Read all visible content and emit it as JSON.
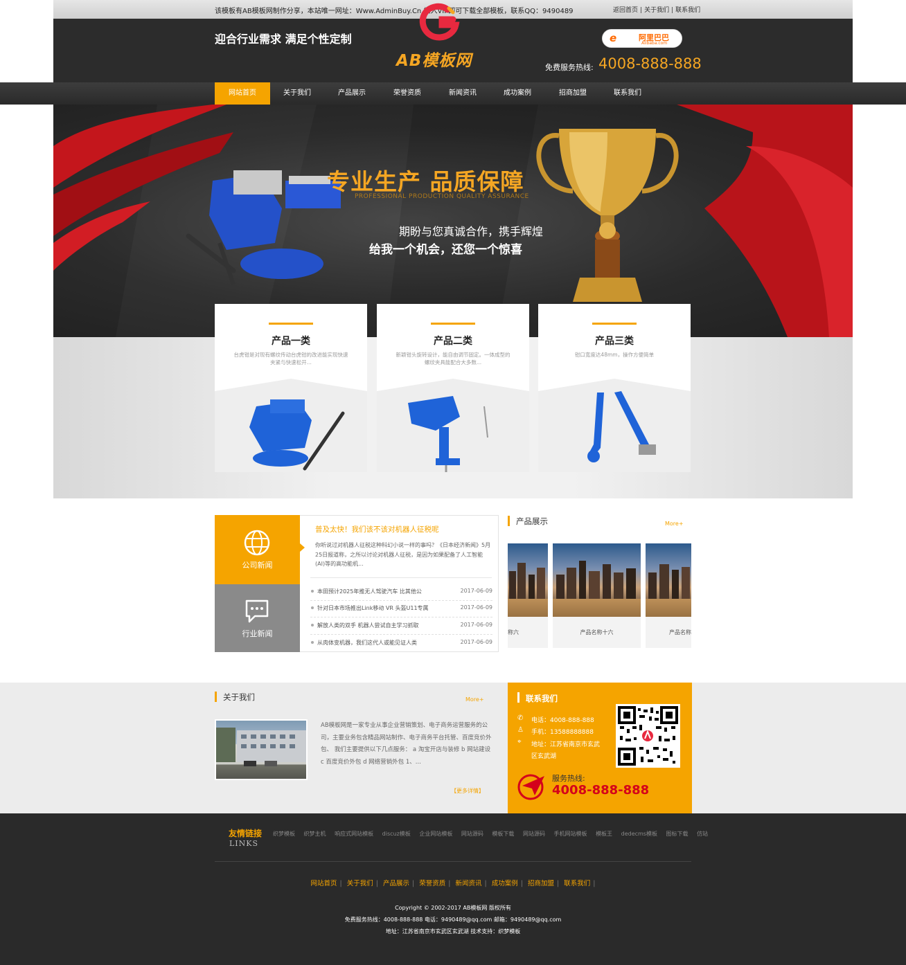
{
  "topbar": {
    "notice": "该模板有AB模板网制作分享，本站唯一网址：Www.AdminBuy.Cn 加入VIP即可下载全部模板，联系QQ：9490489",
    "links": [
      "返回首页",
      "关于我们",
      "联系我们"
    ]
  },
  "header": {
    "slogan": "迎合行业需求 满足个性定制",
    "logo_text": "AB模板网",
    "alibaba_cn": "阿里巴巴",
    "alibaba_en": "Alibaba.com",
    "hotline_label": "免费服务热线:",
    "hotline_number": "4008-888-888"
  },
  "nav": {
    "items": [
      "网站首页",
      "关于我们",
      "产品展示",
      "荣誉资质",
      "新闻资讯",
      "成功案例",
      "招商加盟",
      "联系我们"
    ],
    "active_index": 0
  },
  "banner": {
    "title": "专业生产 品质保障",
    "title_en": "PROFESSIONAL PRODUCTION QUALITY ASSURANCE",
    "sub1": "期盼与您真诚合作，携手辉煌",
    "sub2": "给我一个机会，还您一个惊喜"
  },
  "categories": [
    {
      "title": "产品一类",
      "desc": "台虎钳是对现有螺纹传动台虎钳的改进能实现快速夹紧与快速松开..."
    },
    {
      "title": "产品二类",
      "desc": "新颖钳头旋转设计，能自由调节固定。一体成型的螺纹夹具能配合大多数..."
    },
    {
      "title": "产品三类",
      "desc": "钳口宽度达48mm，操作方便简单"
    }
  ],
  "news": {
    "tab_company": "公司新闻",
    "tab_industry": "行业新闻",
    "headline": "普及太快！我们该不该对机器人征税呢",
    "summary": "你听说过对机器人征税这种科幻小说一样的事吗？《日本经济新闻》5月25日报道称，之所以讨论对机器人征税，是因为如果配备了人工智能(AI)等的高功能机...",
    "items": [
      {
        "title": "本田预计2025年推无人驾驶汽车 比其他公",
        "date": "2017-06-09"
      },
      {
        "title": "针对日本市场推出Link移动 VR 头盔U11专属",
        "date": "2017-06-09"
      },
      {
        "title": "解放人类的双手 机器人尝试自主学习抓取",
        "date": "2017-06-09"
      },
      {
        "title": "从肉体变机器，我们这代人或能见证人类",
        "date": "2017-06-09"
      }
    ]
  },
  "products": {
    "heading": "产品展示",
    "more": "More+",
    "labels": [
      "称六",
      "产品名称十六",
      "产品名称"
    ]
  },
  "about": {
    "heading": "关于我们",
    "more": "More+",
    "text": "AB模板网是一家专业从事企业营销策划、电子商务运营服务的公司，主要业务包含精品网站制作、电子商务平台托管、百度竞价外包、 我们主要提供以下几点服务： a 淘宝开店与装修 b 网站建设 c 百度竞价外包 d 网络营销外包 1、...",
    "detail_link": "【更多详情】"
  },
  "contact": {
    "heading": "联系我们",
    "phone": "电话：4008-888-888",
    "mobile": "手机：13588888888",
    "address_line1": "地址：江苏省南京市玄武",
    "address_line2": "区玄武湖",
    "service_label": "服务热线:",
    "service_number": "4008-888-888"
  },
  "footer": {
    "links_title": "友情链接",
    "links_en": "LINKS",
    "friend_links": [
      "织梦模板",
      "织梦主机",
      "响应式网站模板",
      "discuz模板",
      "企业网站模板",
      "网站源码",
      "模板下载",
      "网站源码",
      "手机网站模板",
      "模板王",
      "dedecms模板",
      "图标下载",
      "仿站"
    ],
    "nav": [
      "网站首页",
      "关于我们",
      "产品展示",
      "荣誉资质",
      "新闻资讯",
      "成功案例",
      "招商加盟",
      "联系我们"
    ],
    "copyright": "Copyright © 2002-2017 AB模板网 版权所有",
    "contact_line": "免费服务热线：4008-888-888 电话：9490489@qq.com 邮箱：9490489@qq.com",
    "address_line": "地址：江苏省南京市玄武区玄武湖 技术支持：织梦模板"
  },
  "colors": {
    "accent": "#f5a400",
    "dark": "#2c2c2c",
    "hotline": "#d4001b"
  }
}
